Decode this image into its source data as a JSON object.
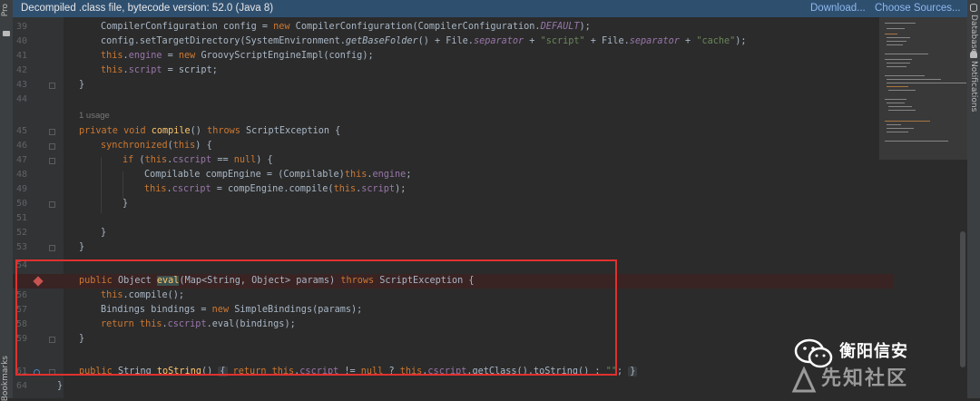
{
  "left_sidebar": {
    "project_label": "Pro",
    "bookmarks_label": "Bookmarks"
  },
  "right_sidebar": {
    "database_label": "Database",
    "notifications_label": "Notifications"
  },
  "banner": {
    "message": "Decompiled .class file, bytecode version: 52.0 (Java 8)",
    "download_label": "Download...",
    "choose_sources_label": "Choose Sources..."
  },
  "editor": {
    "usage_hint": "1 usage",
    "line_numbers": [
      "39",
      "40",
      "41",
      "42",
      "43",
      "44",
      "45",
      "46",
      "47",
      "48",
      "49",
      "50",
      "51",
      "52",
      "53",
      "54",
      "55",
      "56",
      "57",
      "58",
      "59",
      "61",
      "64"
    ],
    "tokens": {
      "l39a": "CompilerConfiguration config = ",
      "l39b": "new",
      "l39c": " CompilerConfiguration(CompilerConfiguration.",
      "l39d": "DEFAULT",
      "l39e": ");",
      "l40a": "config.setTargetDirectory(SystemEnvironment.",
      "l40b": "getBaseFolder",
      "l40c": "() + File.",
      "l40d": "separator",
      "l40e": " + ",
      "l40f": "\"script\"",
      "l40g": " + File.",
      "l40h": "separator",
      "l40i": " + ",
      "l40j": "\"cache\"",
      "l40k": ");",
      "l41a": "this",
      "l41b": ".",
      "l41c": "engine",
      "l41d": " = ",
      "l41e": "new",
      "l41f": " GroovyScriptEngineImpl(config);",
      "l42a": "this",
      "l42b": ".",
      "l42c": "script",
      "l42d": " = script;",
      "l43": "}",
      "l45a": "private void ",
      "l45b": "compile",
      "l45c": "() ",
      "l45d": "throws",
      "l45e": " ScriptException {",
      "l46a": "synchronized",
      "l46b": "(",
      "l46c": "this",
      "l46d": ") {",
      "l47a": "if",
      "l47b": " (",
      "l47c": "this",
      "l47d": ".",
      "l47e": "cscript",
      "l47f": " == ",
      "l47g": "null",
      "l47h": ") {",
      "l48a": "Compilable compEngine = (Compilable)",
      "l48b": "this",
      "l48c": ".",
      "l48d": "engine",
      "l48e": ";",
      "l49a": "this",
      "l49b": ".",
      "l49c": "cscript",
      "l49d": " = compEngine.compile(",
      "l49e": "this",
      "l49f": ".",
      "l49g": "script",
      "l49h": ");",
      "l50": "}",
      "l52": "}",
      "l53": "}",
      "l55a": "public",
      "l55b": " Object ",
      "l55c": "eval",
      "l55d": "(Map<String, Object> params) ",
      "l55e": "throws",
      "l55f": " ScriptException {",
      "l56a": "this",
      "l56b": ".compile();",
      "l57a": "Bindings bindings = ",
      "l57b": "new",
      "l57c": " SimpleBindings(params);",
      "l58a": "return",
      "l58b": " ",
      "l58c": "this",
      "l58d": ".",
      "l58e": "cscript",
      "l58f": ".eval(bindings);",
      "l59": "}",
      "l61a": "public",
      "l61b": " String ",
      "l61c": "toString",
      "l61d": "() ",
      "l61e": "{",
      "l61f": " ",
      "l61g": "return",
      "l61h": " ",
      "l61i": "this",
      "l61j": ".",
      "l61k": "cscript",
      "l61l": " != ",
      "l61m": "null",
      "l61n": " ? ",
      "l61o": "this",
      "l61p": ".",
      "l61q": "cscript",
      "l61r": ".getClass().toString() : ",
      "l61s": "\"\"",
      "l61t": "; ",
      "l61u": "}",
      "l64": "}"
    }
  },
  "watermark": {
    "line1": "衡阳信安",
    "line2": "先知社区"
  },
  "colors": {
    "keyword": "#cc7832",
    "field": "#9876aa",
    "string": "#6a8759",
    "method": "#ffc66d",
    "highlight_box": "#e0312f",
    "banner": "#2f4f6f"
  }
}
